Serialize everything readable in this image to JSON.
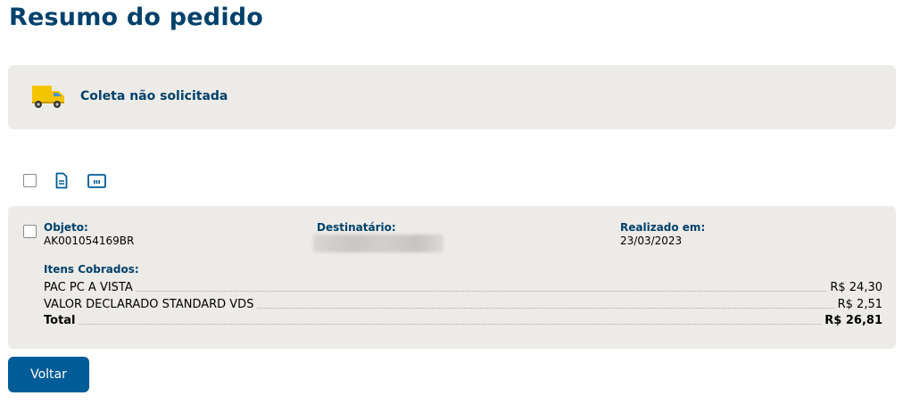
{
  "page": {
    "title": "Resumo do pedido"
  },
  "status": {
    "icon": "delivery-truck-icon",
    "text": "Coleta não solicitada"
  },
  "toolbar": {
    "icons": [
      "select-all-checkbox",
      "document-icon",
      "barcode-label-icon"
    ]
  },
  "order": {
    "object_label": "Objeto:",
    "object_value": "AK001054169BR",
    "recipient_label": "Destinatário:",
    "recipient_value": "",
    "date_label": "Realizado em:",
    "date_value": "23/03/2023",
    "items_label": "Itens Cobrados:",
    "items": [
      {
        "name": "PAC PC A VISTA",
        "amount": "R$ 24,30"
      },
      {
        "name": "VALOR DECLARADO STANDARD VDS",
        "amount": "R$ 2,51"
      }
    ],
    "total_label": "Total",
    "total_amount": "R$ 26,81"
  },
  "actions": {
    "back_label": "Voltar"
  },
  "colors": {
    "primary": "#00416b",
    "button": "#005c96",
    "panel": "#edebe7",
    "truck": "#f5c400"
  }
}
